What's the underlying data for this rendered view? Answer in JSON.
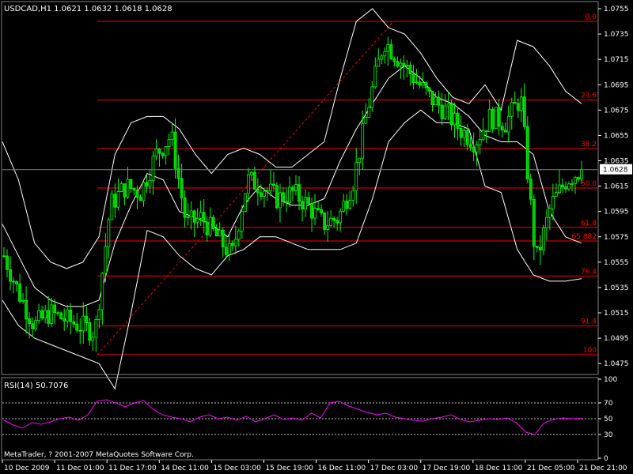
{
  "chart_data": {
    "type": "candlestick",
    "symbol_header": "USDCAD,H1  1.0621 1.0632 1.0618 1.0628",
    "current_price_label": "1.0628",
    "current_price": 1.0628,
    "ylim": [
      1.0467,
      1.076
    ],
    "y_ticks": [
      "1.0755",
      "1.0735",
      "1.0715",
      "1.0695",
      "1.0675",
      "1.0655",
      "1.0635",
      "1.0615",
      "1.0595",
      "1.0575",
      "1.0555",
      "1.0535",
      "1.0515",
      "1.0495",
      "1.0475"
    ],
    "x_ticks": [
      "10 Dec 2009",
      "11 Dec 01:00",
      "11 Dec 17:00",
      "14 Dec 11:00",
      "15 Dec 03:00",
      "15 Dec 19:00",
      "16 Dec 11:00",
      "17 Dec 03:00",
      "17 Dec 19:00",
      "18 Dec 11:00",
      "21 Dec 05:00",
      "21 Dec 21:00"
    ],
    "fibonacci": {
      "high": 1.0745,
      "low": 1.0482,
      "levels": [
        {
          "label": "0.0",
          "ratio": 0.0
        },
        {
          "label": "23.6",
          "ratio": 0.236
        },
        {
          "label": "38.2",
          "ratio": 0.382
        },
        {
          "label": "50.0",
          "ratio": 0.5
        },
        {
          "label": "61.8",
          "ratio": 0.618
        },
        {
          "label": "65.882",
          "ratio": 0.65882
        },
        {
          "label": "76.4",
          "ratio": 0.764
        },
        {
          "label": "91.4",
          "ratio": 0.914
        },
        {
          "label": "100",
          "ratio": 1.0
        }
      ]
    },
    "bollinger_middle": [
      1.0585,
      1.056,
      1.0535,
      1.0525,
      1.052,
      1.052,
      1.0525,
      1.057,
      1.06,
      1.0625,
      1.062,
      1.0595,
      1.059,
      1.0585,
      1.0575,
      1.06,
      1.0615,
      1.0605,
      1.06,
      1.06,
      1.0605,
      1.0635,
      1.066,
      1.068,
      1.07,
      1.071,
      1.07,
      1.0685,
      1.068,
      1.067,
      1.0655,
      1.065,
      1.065,
      1.064,
      1.0595,
      1.0575,
      1.057
    ],
    "bollinger_upper": [
      1.065,
      1.062,
      1.057,
      1.0555,
      1.055,
      1.0555,
      1.0575,
      1.064,
      1.0665,
      1.067,
      1.067,
      1.066,
      1.064,
      1.0625,
      1.064,
      1.0645,
      1.064,
      1.063,
      1.063,
      1.064,
      1.065,
      1.07,
      1.0745,
      1.0755,
      1.074,
      1.0735,
      1.072,
      1.07,
      1.0685,
      1.068,
      1.0695,
      1.0675,
      1.073,
      1.0725,
      1.071,
      1.069,
      1.068
    ],
    "bollinger_lower": [
      1.0525,
      1.0505,
      1.0495,
      1.049,
      1.0485,
      1.048,
      1.0475,
      1.0455,
      1.0515,
      1.058,
      1.0575,
      1.056,
      1.055,
      1.0545,
      1.056,
      1.0565,
      1.0575,
      1.0575,
      1.057,
      1.0565,
      1.0565,
      1.0565,
      1.057,
      1.0605,
      1.065,
      1.0665,
      1.0675,
      1.0665,
      1.0665,
      1.066,
      1.0615,
      1.061,
      1.0565,
      1.0545,
      1.054,
      1.054,
      1.0542
    ],
    "price_path": [
      1.056,
      1.053,
      1.0505,
      1.0515,
      1.051,
      1.0505,
      1.05,
      1.06,
      1.0615,
      1.061,
      1.064,
      1.0655,
      1.0585,
      1.059,
      1.0575,
      1.056,
      1.062,
      1.0615,
      1.0605,
      1.061,
      1.06,
      1.0585,
      1.059,
      1.062,
      1.068,
      1.073,
      1.0715,
      1.07,
      1.0685,
      1.0675,
      1.066,
      1.065,
      1.067,
      1.0665,
      1.0685,
      1.0555,
      1.06,
      1.062,
      1.0628
    ],
    "rsi": {
      "label": "RSI(14) 50.7076",
      "ylim": [
        0,
        100
      ],
      "y_ticks": [
        "100",
        "70",
        "50",
        "30",
        "0"
      ],
      "levels": [
        70,
        50,
        30
      ],
      "values": [
        48,
        42,
        38,
        45,
        43,
        46,
        50,
        52,
        48,
        55,
        72,
        74,
        70,
        65,
        70,
        73,
        62,
        55,
        52,
        50,
        46,
        52,
        55,
        50,
        52,
        48,
        53,
        46,
        50,
        55,
        49,
        51,
        48,
        57,
        51,
        70,
        72,
        66,
        62,
        58,
        55,
        57,
        52,
        50,
        48,
        47,
        50,
        52,
        55,
        49,
        46,
        48,
        50,
        49,
        51,
        45,
        33,
        30,
        45,
        49,
        51,
        50,
        50.7
      ]
    },
    "copyright": "MetaTrader, ? 2001-2007 MetaQuotes Software Corp.",
    "colors": {
      "background": "#000000",
      "candle_up": "#00ff00",
      "candle_down": "#00c800",
      "fibo": "#ff0000",
      "bands": "#ffffff",
      "rsi_line": "#ff00ff",
      "axis_text": "#ffffff",
      "frame": "#808080"
    }
  }
}
